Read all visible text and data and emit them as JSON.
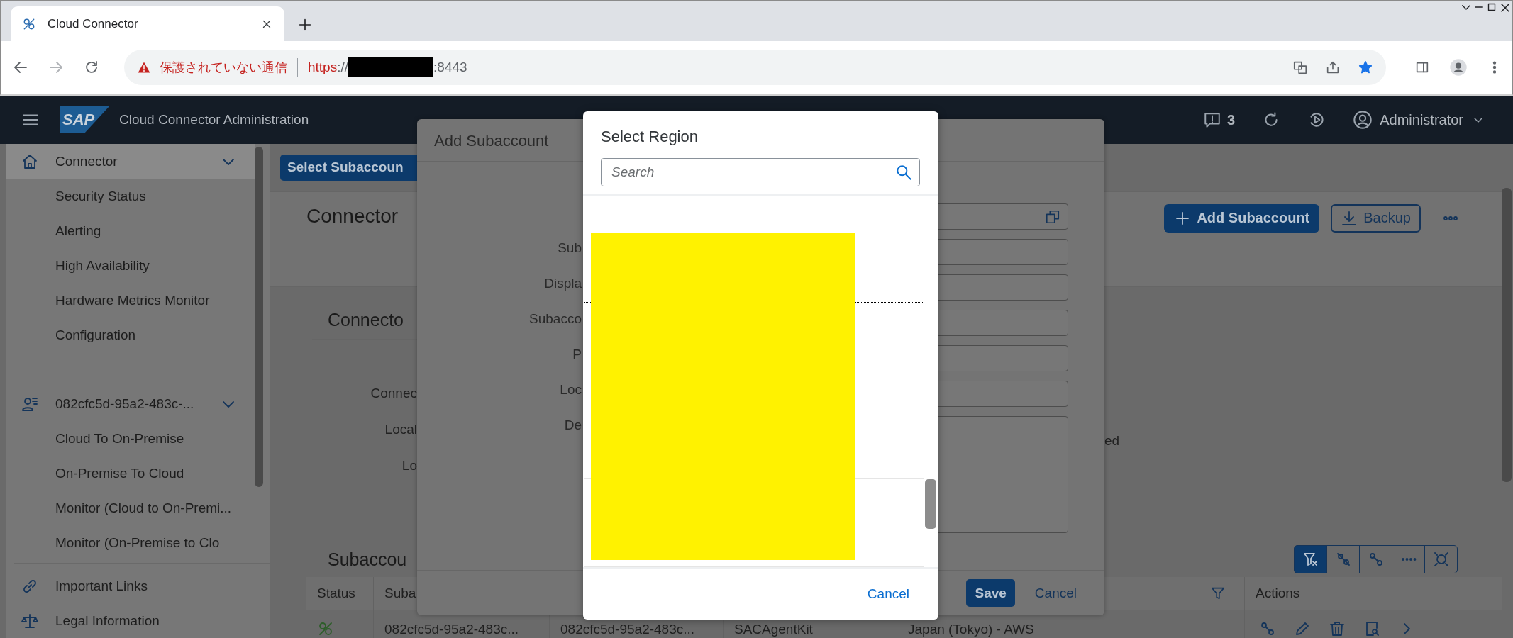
{
  "browser": {
    "tab": {
      "title": "Cloud Connector"
    },
    "address": {
      "warning": "保護されていない通信",
      "scheme": "https",
      "separator": "://",
      "port": ":8443"
    }
  },
  "shell": {
    "logo": "SAP",
    "title": "Cloud Connector Administration",
    "notifications": "3",
    "user": "Administrator"
  },
  "sidebar": {
    "groups": [
      {
        "label": "Connector",
        "expanded": true,
        "selected": true,
        "children": [
          {
            "label": "Security Status"
          },
          {
            "label": "Alerting"
          },
          {
            "label": "High Availability"
          },
          {
            "label": "Hardware Metrics Monitor"
          },
          {
            "label": "Configuration"
          }
        ]
      },
      {
        "label": "082cfc5d-95a2-483c-...",
        "expanded": true,
        "selected": false,
        "children": [
          {
            "label": "Cloud To On-Premise"
          },
          {
            "label": "On-Premise To Cloud"
          },
          {
            "label": "Monitor (Cloud to On-Premi..."
          },
          {
            "label": "Monitor (On-Premise to Clo"
          }
        ]
      }
    ],
    "footer_items": [
      {
        "label": "Important Links"
      },
      {
        "label": "Legal Information"
      }
    ]
  },
  "page": {
    "select_subaccount": "Select Subaccoun",
    "title": "Connector",
    "add_button": "Add Subaccount",
    "backup_button": "Backup",
    "section_title": "Connecto",
    "fields": [
      {
        "label": "Connec"
      },
      {
        "label": "Local",
        "value": "ed"
      },
      {
        "label": "Lo"
      }
    ],
    "subaccounts": {
      "title": "Subaccou",
      "toolbar": [
        {
          "selected": true
        },
        {
          "selected": false
        },
        {
          "selected": false
        },
        {
          "selected": false
        },
        {
          "selected": false
        }
      ],
      "columns": {
        "status": "Status",
        "column_2": "Suba",
        "actions": "Actions"
      },
      "rows": [
        {
          "cells": [
            "082cfc5d-95a2-483c...",
            "082cfc5d-95a2-483c...",
            "SACAgentKit",
            "Japan (Tokyo) - AWS"
          ]
        }
      ]
    }
  },
  "add_dialog": {
    "title": "Add Subaccount",
    "labels": [
      "Sub",
      "Displa",
      "Subacco",
      "P",
      "Loc",
      "De"
    ],
    "inputs": [
      {
        "kind": "value-help"
      },
      {
        "kind": "text"
      },
      {
        "kind": "text"
      },
      {
        "kind": "text"
      },
      {
        "kind": "text"
      },
      {
        "kind": "text"
      },
      {
        "kind": "textarea"
      }
    ],
    "save": "Save",
    "cancel": "Cancel"
  },
  "region_dialog": {
    "title": "Select Region",
    "search": {
      "placeholder": "Search"
    },
    "items": [
      {
        "focused": true
      },
      {
        "focused": false
      },
      {
        "focused": false
      },
      {
        "focused": false
      }
    ],
    "cancel": "Cancel"
  }
}
